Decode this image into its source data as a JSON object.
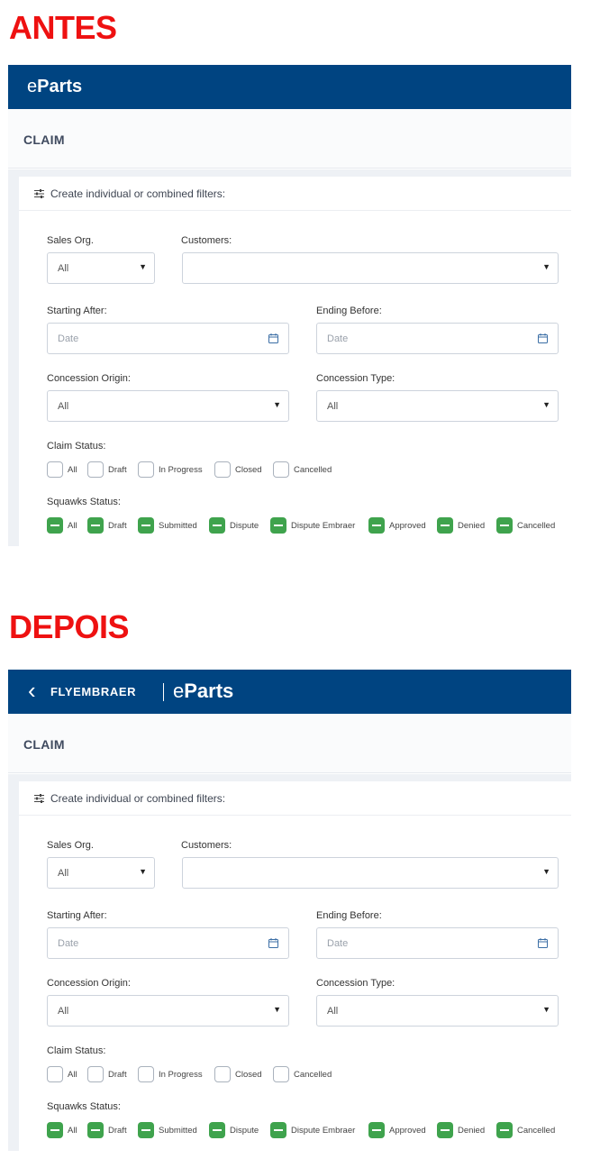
{
  "before": {
    "heading": "ANTES",
    "topbar": {
      "brand_e": "e",
      "brand_parts": "Parts"
    },
    "page_title": "CLAIM",
    "filters": {
      "title": "Create individual or combined filters:",
      "sales_org": {
        "label": "Sales Org.",
        "value": "All"
      },
      "customers": {
        "label": "Customers:",
        "value": ""
      },
      "starting_after": {
        "label": "Starting After:",
        "placeholder": "Date"
      },
      "ending_before": {
        "label": "Ending Before:",
        "placeholder": "Date"
      },
      "concession_origin": {
        "label": "Concession Origin:",
        "value": "All"
      },
      "concession_type": {
        "label": "Concession Type:",
        "value": "All"
      },
      "claim_status": {
        "label": "Claim Status:",
        "options": [
          "All",
          "Draft",
          "In Progress",
          "Closed",
          "Cancelled"
        ]
      },
      "squawks_status": {
        "label": "Squawks Status:",
        "options": [
          "All",
          "Draft",
          "Submitted",
          "Dispute",
          "Dispute Embraer",
          "Approved",
          "Denied",
          "Cancelled"
        ]
      }
    }
  },
  "after": {
    "heading": "DEPOIS",
    "topbar": {
      "back_glyph": "‹",
      "fly": "FLYEMBRAER",
      "brand_e": "e",
      "brand_parts": "Parts"
    },
    "page_title": "CLAIM",
    "filters": {
      "title": "Create individual or combined filters:",
      "sales_org": {
        "label": "Sales Org.",
        "value": "All"
      },
      "customers": {
        "label": "Customers:",
        "value": ""
      },
      "starting_after": {
        "label": "Starting After:",
        "placeholder": "Date"
      },
      "ending_before": {
        "label": "Ending Before:",
        "placeholder": "Date"
      },
      "concession_origin": {
        "label": "Concession Origin:",
        "value": "All"
      },
      "concession_type": {
        "label": "Concession Type:",
        "value": "All"
      },
      "claim_status": {
        "label": "Claim Status:",
        "options": [
          "All",
          "Draft",
          "In Progress",
          "Closed",
          "Cancelled"
        ]
      },
      "squawks_status": {
        "label": "Squawks Status:",
        "options": [
          "All",
          "Draft",
          "Submitted",
          "Dispute",
          "Dispute Embraer",
          "Approved",
          "Denied",
          "Cancelled"
        ]
      }
    }
  },
  "icons": {
    "filter": "sliders-icon",
    "calendar": "calendar-icon",
    "dropdown": "caret-down-icon",
    "checked": "indeterminate-checkbox-icon"
  },
  "colors": {
    "header_bg": "#004481",
    "heading_red": "#ee1111",
    "squawk_green": "#3fa34d"
  }
}
